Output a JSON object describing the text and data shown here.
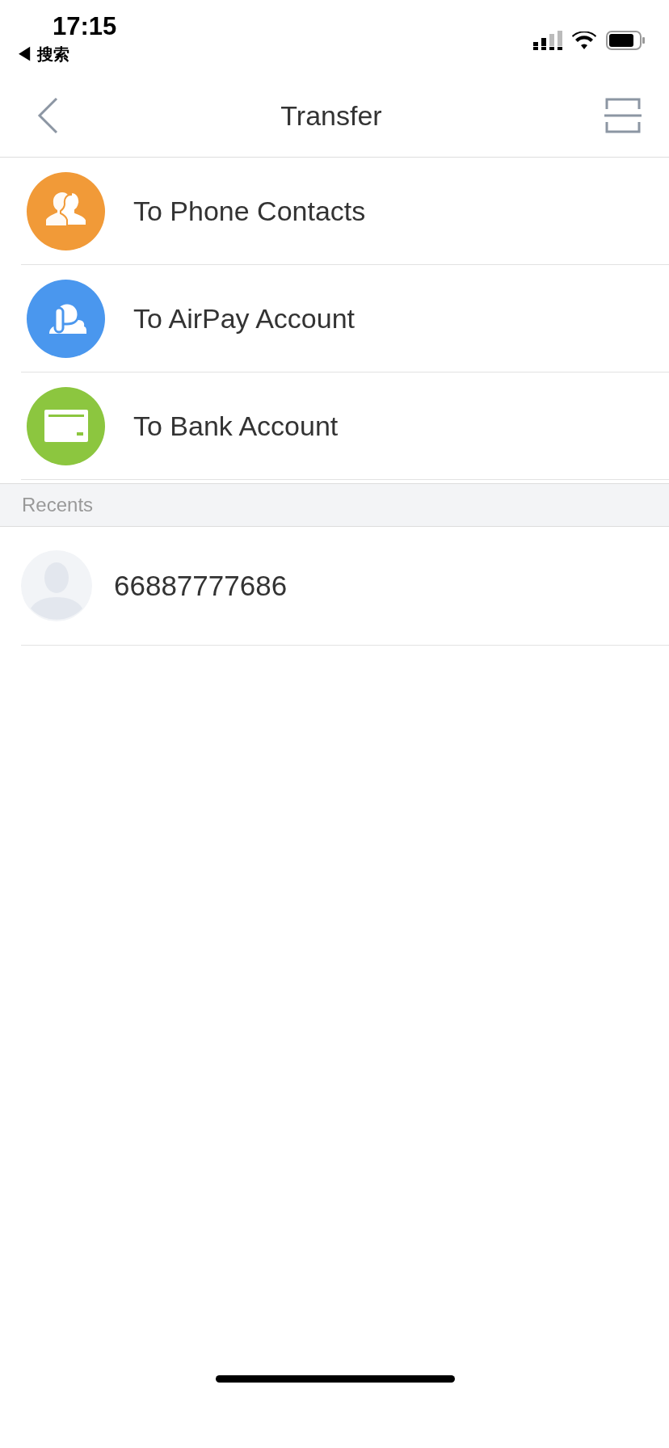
{
  "status_bar": {
    "time": "17:15",
    "back_app": "◀ 搜索"
  },
  "nav": {
    "title": "Transfer"
  },
  "options": [
    {
      "kind": "contacts",
      "label": "To Phone Contacts",
      "color": "#f19a38"
    },
    {
      "kind": "airpay",
      "label": "To AirPay Account",
      "color": "#4a97ee"
    },
    {
      "kind": "bank",
      "label": "To Bank Account",
      "color": "#8cc63f"
    }
  ],
  "recents": {
    "header": "Recents",
    "items": [
      {
        "number": "66887777686"
      }
    ]
  }
}
